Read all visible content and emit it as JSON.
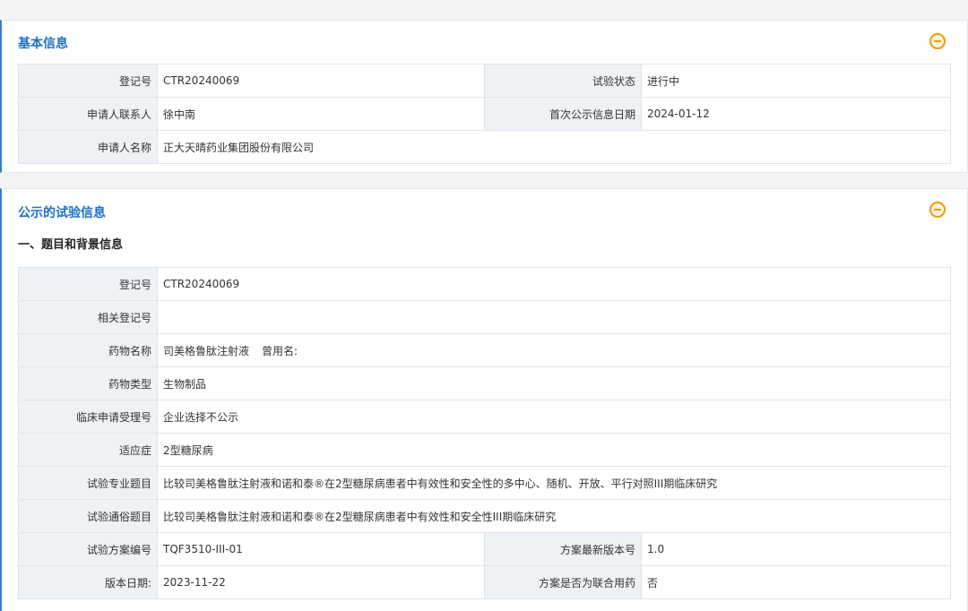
{
  "basic": {
    "title": "基本信息",
    "rows": [
      {
        "l1": "登记号",
        "v1": "CTR20240069",
        "l2": "试验状态",
        "v2": "进行中"
      },
      {
        "l1": "申请人联系人",
        "v1": "徐中南",
        "l2": "首次公示信息日期",
        "v2": "2024-01-12"
      }
    ],
    "applicant_label": "申请人名称",
    "applicant_value": "正大天晴药业集团股份有限公司"
  },
  "trial": {
    "title": "公示的试验信息",
    "section_title": "一、题目和背景信息",
    "reg_no_label": "登记号",
    "reg_no_value": "CTR20240069",
    "related_label": "相关登记号",
    "related_value": "",
    "drug_name_label": "药物名称",
    "drug_name_value": "司美格鲁肽注射液",
    "former_name_label": "曾用名:",
    "former_name_value": "",
    "drug_type_label": "药物类型",
    "drug_type_value": "生物制品",
    "acceptance_label": "临床申请受理号",
    "acceptance_value": "企业选择不公示",
    "indication_label": "适应症",
    "indication_value": "2型糖尿病",
    "sci_title_label": "试验专业题目",
    "sci_title_value": "比较司美格鲁肽注射液和诺和泰®在2型糖尿病患者中有效性和安全性的多中心、随机、开放、平行对照III期临床研究",
    "pop_title_label": "试验通俗题目",
    "pop_title_value": "比较司美格鲁肽注射液和诺和泰®在2型糖尿病患者中有效性和安全性III期临床研究",
    "protocol_no_label": "试验方案编号",
    "protocol_no_value": "TQF3510-III-01",
    "protocol_ver_label": "方案最新版本号",
    "protocol_ver_value": "1.0",
    "version_date_label": "版本日期:",
    "version_date_value": "2023-11-22",
    "combo_label": "方案是否为联合用药",
    "combo_value": "否"
  },
  "icons": {
    "collapse": "collapse-minus-icon"
  },
  "colors": {
    "accent": "#1f6fc5",
    "label_bg": "#eef1f6",
    "collapse": "#f39800",
    "border": "#dfe3e8"
  }
}
